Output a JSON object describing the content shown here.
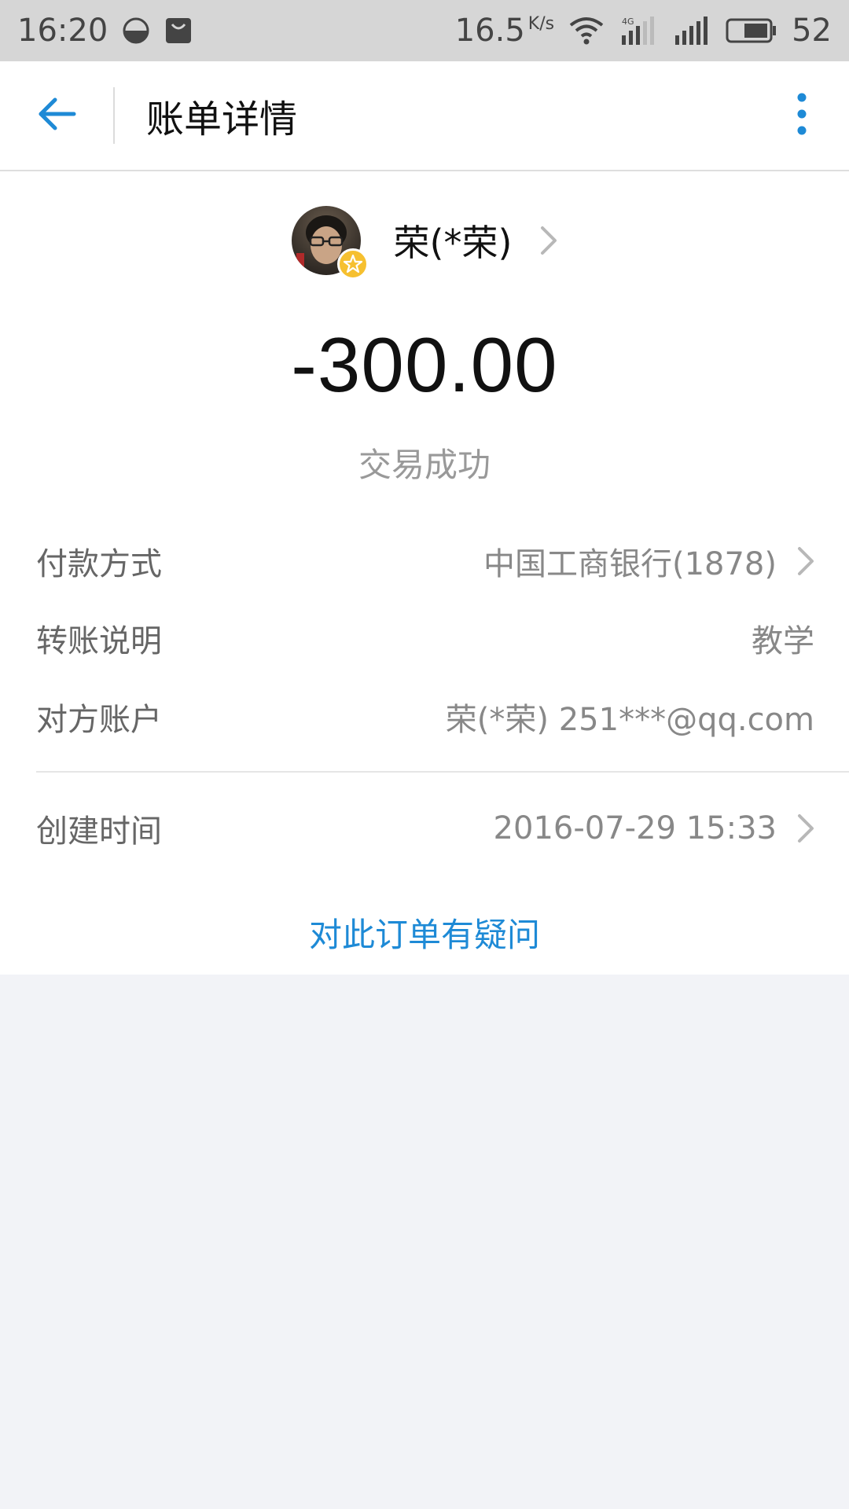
{
  "status_bar": {
    "time": "16:20",
    "speed": "16.5",
    "speed_unit": "K/s",
    "network": "4G",
    "battery": "52"
  },
  "header": {
    "title": "账单详情",
    "back_icon": "arrow-left-icon",
    "more_icon": "more-vertical-icon"
  },
  "payee": {
    "name": "荣(*荣)"
  },
  "amount": "-300.00",
  "status": "交易成功",
  "details": [
    {
      "label": "付款方式",
      "value": "中国工商银行(1878)",
      "has_chevron": true
    },
    {
      "label": "转账说明",
      "value": "教学",
      "has_chevron": false
    },
    {
      "label": "对方账户",
      "value": "荣(*荣) 251***@qq.com",
      "has_chevron": false
    }
  ],
  "created": {
    "label": "创建时间",
    "value": "2016-07-29 15:33"
  },
  "question_link": "对此订单有疑问",
  "colors": {
    "accent": "#1e8ad6",
    "background": "#f2f3f7",
    "status_bar": "#d6d6d6"
  }
}
